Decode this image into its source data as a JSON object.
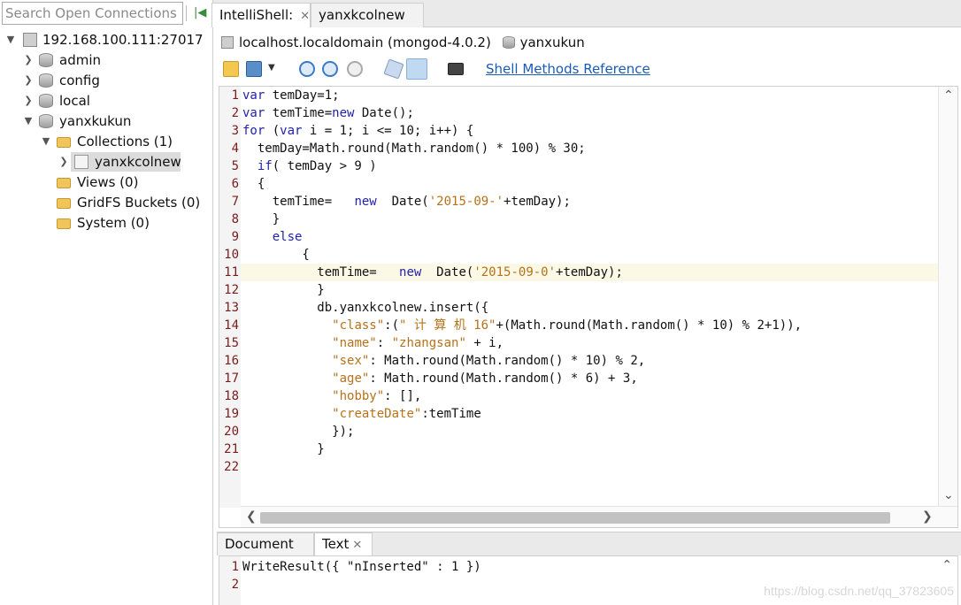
{
  "search": {
    "placeholder": "Search Open Connections ("
  },
  "tree": {
    "connection": "192.168.100.111:27017",
    "databases": [
      "admin",
      "config",
      "local",
      "yanxkukun"
    ],
    "collections_label": "Collections (1)",
    "collection_item": "yanxkcolnew",
    "views_label": "Views (0)",
    "gridfs_label": "GridFS Buckets (0)",
    "system_label": "System (0)"
  },
  "tabs": {
    "intellishell": "IntelliShell:",
    "second": "yanxkcolnew",
    "close_glyph": "✕"
  },
  "connection_bar": {
    "host": "localhost.localdomain (mongod-4.0.2)",
    "database": "yanxukun"
  },
  "toolbar": {
    "shell_methods_link": "Shell Methods Reference"
  },
  "editor": {
    "line_numbers": [
      "1",
      "2",
      "3",
      "4",
      "5",
      "6",
      "7",
      "8",
      "9",
      "10",
      "11",
      "12",
      "13",
      "14",
      "15",
      "16",
      "17",
      "18",
      "19",
      "20",
      "21",
      "22"
    ],
    "lines": [
      "var temDay=1;",
      "var temTime=new Date();",
      "for (var i = 1; i <= 10; i++) {",
      "  temDay=Math.round(Math.random() * 100) % 30;",
      "  if( temDay > 9 )",
      "  {",
      "    temTime=   new  Date('2015-09-'+temDay);",
      "    }",
      "    else",
      "        {",
      "          temTime=   new  Date('2015-09-0'+temDay);",
      "          }",
      "          db.yanxkcolnew.insert({",
      "            \"class\":(\" 计 算 机 16\"+(Math.round(Math.random() * 10) % 2+1)),",
      "            \"name\": \"zhangsan\" + i,",
      "            \"sex\": Math.round(Math.random() * 10) % 2,",
      "            \"age\": Math.round(Math.random() * 6) + 3,",
      "            \"hobby\": [],",
      "            \"createDate\":temTime",
      "            });",
      "          }",
      ""
    ]
  },
  "bottom_tabs": {
    "document": "Document",
    "text": "Text"
  },
  "result": {
    "line_numbers": [
      "1",
      "2"
    ],
    "line1": "WriteResult({ \"nInserted\" : 1 })"
  },
  "watermark": "https://blog.csdn.net/qq_37823605"
}
